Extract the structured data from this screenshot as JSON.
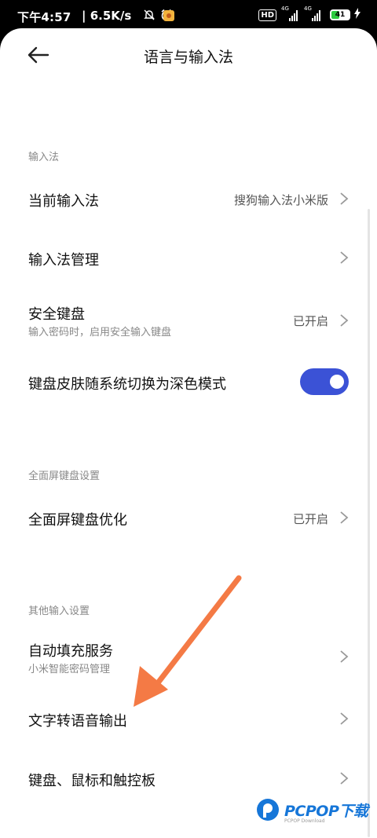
{
  "status_bar": {
    "time": "下午4:57",
    "speed": "| 6.5K/s",
    "network_badge": "HD",
    "sim1": "4G",
    "sim2": "4G",
    "battery": "41"
  },
  "header": {
    "title": "语言与输入法"
  },
  "sections": {
    "input_method": {
      "label": "输入法",
      "current": {
        "label": "当前输入法",
        "value": "搜狗输入法小米版"
      },
      "manage": {
        "label": "输入法管理"
      },
      "secure_keyboard": {
        "label": "安全键盘",
        "sub": "输入密码时，启用安全输入键盘",
        "value": "已开启"
      },
      "dark_skin": {
        "label": "键盘皮肤随系统切换为深色模式",
        "enabled": true
      }
    },
    "fullscreen": {
      "label": "全面屏键盘设置",
      "optimize": {
        "label": "全面屏键盘优化",
        "value": "已开启"
      }
    },
    "other": {
      "label": "其他输入设置",
      "autofill": {
        "label": "自动填充服务",
        "sub": "小米智能密码管理"
      },
      "tts": {
        "label": "文字转语音输出"
      },
      "keyboard_mouse": {
        "label": "键盘、鼠标和触控板"
      }
    }
  },
  "colors": {
    "accent": "#3b52d6",
    "arrow": "#f47a45"
  },
  "watermark": {
    "brand": "PCPOP下载",
    "sub": "PCPOP Download"
  }
}
